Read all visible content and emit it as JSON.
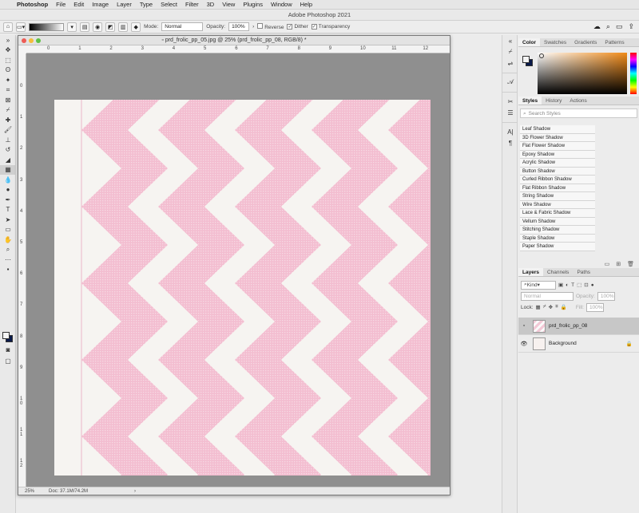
{
  "menubar": {
    "app": "Photoshop",
    "items": [
      "File",
      "Edit",
      "Image",
      "Layer",
      "Type",
      "Select",
      "Filter",
      "3D",
      "View",
      "Plugins",
      "Window",
      "Help"
    ]
  },
  "window_title": "Adobe Photoshop 2021",
  "options": {
    "mode_label": "Mode:",
    "mode_value": "Normal",
    "opacity_label": "Opacity:",
    "opacity_value": "100%",
    "reverse_label": "Reverse",
    "dither_label": "Dither",
    "transparency_label": "Transparency"
  },
  "document": {
    "tab_title": "prd_frolic_pp_05.jpg @ 25% (prd_frolic_pp_08, RGB/8) *",
    "zoom": "25%",
    "doc_size": "Doc: 37.1M/74.2M",
    "status_arrow": "›",
    "ruler_h": [
      "0",
      "1",
      "2",
      "3",
      "4",
      "5",
      "6",
      "7",
      "8",
      "9",
      "10",
      "11",
      "12"
    ],
    "ruler_v": [
      "0",
      "1",
      "2",
      "3",
      "4",
      "5",
      "6",
      "7",
      "8",
      "9",
      "1 0",
      "1 1",
      "1 2"
    ]
  },
  "color_panel": {
    "tabs": [
      "Color",
      "Swatches",
      "Gradients",
      "Patterns"
    ],
    "fg": "#f4f4f4",
    "bg": "#0a1a4a"
  },
  "styles_panel": {
    "tabs": [
      "Styles",
      "History",
      "Actions"
    ],
    "search_placeholder": "Search Styles",
    "items": [
      "Leaf Shadow",
      "3D Flower Shadow",
      "Flat Flower Shadow",
      "Epoxy Shadow",
      "Acrylic Shadow",
      "Button Shadow",
      "Curled Ribbon Shadow",
      "Flat Ribbon Shadow",
      "String Shadow",
      "Wire Shadow",
      "Lace & Fabric Shadow",
      "Vellum Shadow",
      "Stitching Shadow",
      "Staple Shadow",
      "Paper Shadow"
    ]
  },
  "layers_panel": {
    "tabs": [
      "Layers",
      "Channels",
      "Paths"
    ],
    "filter_kind": "Kind",
    "blend_mode": "Normal",
    "opacity_label": "Opacity:",
    "opacity_value": "100%",
    "lock_label": "Lock:",
    "fill_label": "Fill:",
    "fill_value": "100%",
    "layers": [
      {
        "name": "prd_frolic_pp_08",
        "selected": true,
        "visible": false,
        "locked": false
      },
      {
        "name": "Background",
        "selected": false,
        "visible": true,
        "locked": true
      }
    ]
  },
  "colors": {
    "chevron_pink": "#f1a9c3",
    "paper": "#f6f4f1",
    "canvas_gray": "#8f8f8f"
  }
}
